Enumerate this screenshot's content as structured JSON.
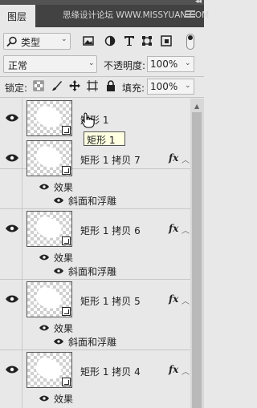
{
  "panel": {
    "tab_label": "图层",
    "watermark": "思缘设计论坛 WWW.MISSYUAN.COM"
  },
  "filter": {
    "kind_label": "类型",
    "icons": [
      "image-filter-icon",
      "adjustment-filter-icon",
      "type-filter-icon",
      "shape-filter-icon",
      "smart-object-filter-icon"
    ]
  },
  "blend": {
    "mode": "正常",
    "opacity_label": "不透明度:",
    "opacity_value": "100%"
  },
  "lock": {
    "label": "锁定:",
    "icons": [
      "lock-transparent-pixels-icon",
      "lock-image-pixels-icon",
      "lock-position-icon",
      "lock-artboard-icon",
      "lock-all-icon"
    ],
    "fill_label": "填充:",
    "fill_value": "100%"
  },
  "tooltip": "矩形 1",
  "layers": [
    {
      "name": "矩形 1",
      "has_fx": false
    },
    {
      "name": "矩形 1 拷贝 7",
      "has_fx": true,
      "effects_label": "效果",
      "effect": "斜面和浮雕"
    },
    {
      "name": "矩形 1 拷贝 6",
      "has_fx": true,
      "effects_label": "效果",
      "effect": "斜面和浮雕"
    },
    {
      "name": "矩形 1 拷贝 5",
      "has_fx": true,
      "effects_label": "效果",
      "effect": "斜面和浮雕"
    },
    {
      "name": "矩形 1 拷贝 4",
      "has_fx": true,
      "effects_label": "效果",
      "effect": ""
    }
  ],
  "fx_symbol": "fx"
}
